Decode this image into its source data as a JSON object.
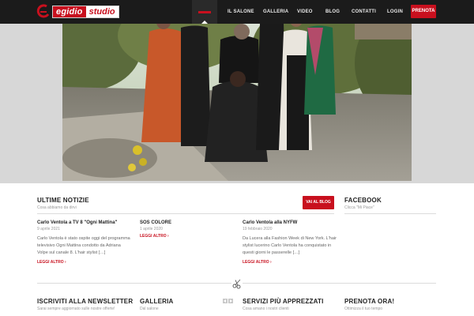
{
  "brand": {
    "logo_part1": "egidio",
    "logo_part2": "studio"
  },
  "nav": {
    "items": [
      {
        "label": "IL SALONE"
      },
      {
        "label": "GALLERIA"
      },
      {
        "label": "VIDEO"
      },
      {
        "label": "BLOG"
      },
      {
        "label": "CONTATTI"
      },
      {
        "label": "LOGIN"
      }
    ],
    "cta": "PRENOTA"
  },
  "news": {
    "title": "ULTIME NOTIZIE",
    "subtitle": "Cosa abbiamo da dirvi",
    "button": "VAI AL BLOG",
    "posts": [
      {
        "title": "Carlo Ventola a TV 8 \"Ogni Mattina\"",
        "date": "9 aprile 2021",
        "excerpt": "Carlo Ventola è stato ospite oggi del programma televisivo Ogni Mattina condotto da Adriana Volpe sul canale 8. L'hair stylist […]",
        "more": "LEGGI ALTRO ›"
      },
      {
        "title": "SOS COLORE",
        "date": "1 aprile 2020",
        "excerpt": "",
        "more": "LEGGI ALTRO ›"
      },
      {
        "title": "Carlo Ventola alla NYFW",
        "date": "19 febbraio 2020",
        "excerpt": "Da Lucera alla Fashion Week di New York. L'hair stylist lucerino Carlo Ventola ha conquistato in questi giorni le passerelle […]",
        "more": "LEGGI ALTRO ›"
      }
    ]
  },
  "facebook": {
    "title": "FACEBOOK",
    "subtitle": "Clicca \"Mi Piace\""
  },
  "newsletter": {
    "title": "ISCRIVITI ALLA NEWSLETTER",
    "subtitle": "Sarai sempre aggiornato sulle nostre offerte!"
  },
  "gallery": {
    "title": "GALLERIA",
    "subtitle": "Dal salone"
  },
  "services": {
    "title": "SERVIZI PIÙ APPREZZATI",
    "subtitle": "Cosa amano i nostri clienti"
  },
  "booking": {
    "title": "PRENOTA ORA!",
    "subtitle": "Ottimizza il tuo tempo"
  },
  "icons": {
    "scissors": "scissors-icon",
    "arrow_left": "arrow-left-icon",
    "arrow_right": "arrow-right-icon"
  },
  "colors": {
    "accent": "#c8101e",
    "header": "#1b1b1b"
  }
}
